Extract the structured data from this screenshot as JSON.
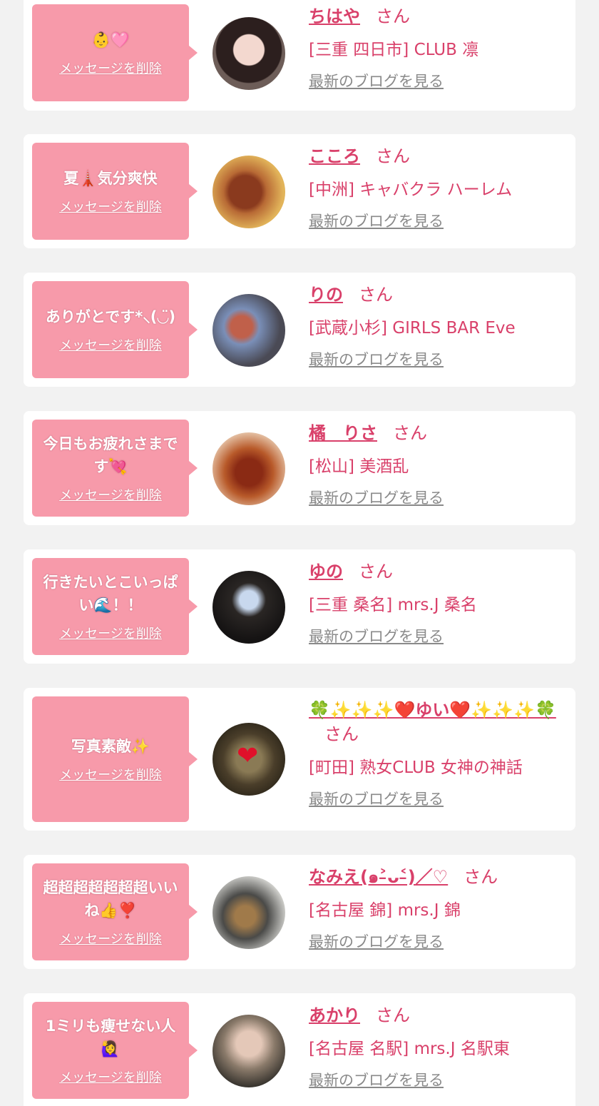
{
  "delete_label": "メッセージを削除",
  "blog_label": "最新のブログを見る",
  "honorific": "さん",
  "colors": {
    "bubble": "#f79aaa",
    "accent": "#d9406a",
    "background": "#f2f2f2",
    "muted": "#8a8a8a"
  },
  "cards": [
    {
      "message": "👶🩷",
      "name": "ちはや",
      "shop": "[三重 四日市] CLUB 凛",
      "avatar_icon": "profile-photo"
    },
    {
      "message": "夏🗼気分爽快",
      "name": "こころ",
      "shop": "[中洲] キャバクラ ハーレム",
      "avatar_icon": "profile-photo"
    },
    {
      "message": "ありがとです*⸜(◡̈)",
      "name": "りの",
      "shop": "[武蔵小杉] GIRLS BAR Eve",
      "avatar_icon": "profile-photo"
    },
    {
      "message": "今日もお疲れさまです💘",
      "name": "橘　りさ",
      "shop": "[松山] 美酒乱",
      "avatar_icon": "profile-photo"
    },
    {
      "message": "行きたいとこいっぱい🌊！！",
      "name": "ゆの",
      "shop": "[三重 桑名] mrs.J 桑名",
      "avatar_icon": "profile-photo"
    },
    {
      "message": "写真素敵✨",
      "name": "🍀✨✨✨❤️ゆい❤️✨✨✨🍀",
      "shop": "[町田] 熟女CLUB 女神の神話",
      "avatar_icon": "profile-photo"
    },
    {
      "message": "超超超超超超超いいね👍❣️",
      "name": "なみえ(๑˃̵ᴗ˂̵)／♡",
      "shop": "[名古屋 錦] mrs.J 錦",
      "avatar_icon": "profile-photo"
    },
    {
      "message": "1ミリも痩せない人🙋‍♀️",
      "name": "あかり",
      "shop": "[名古屋 名駅] mrs.J 名駅東",
      "avatar_icon": "profile-photo"
    }
  ]
}
